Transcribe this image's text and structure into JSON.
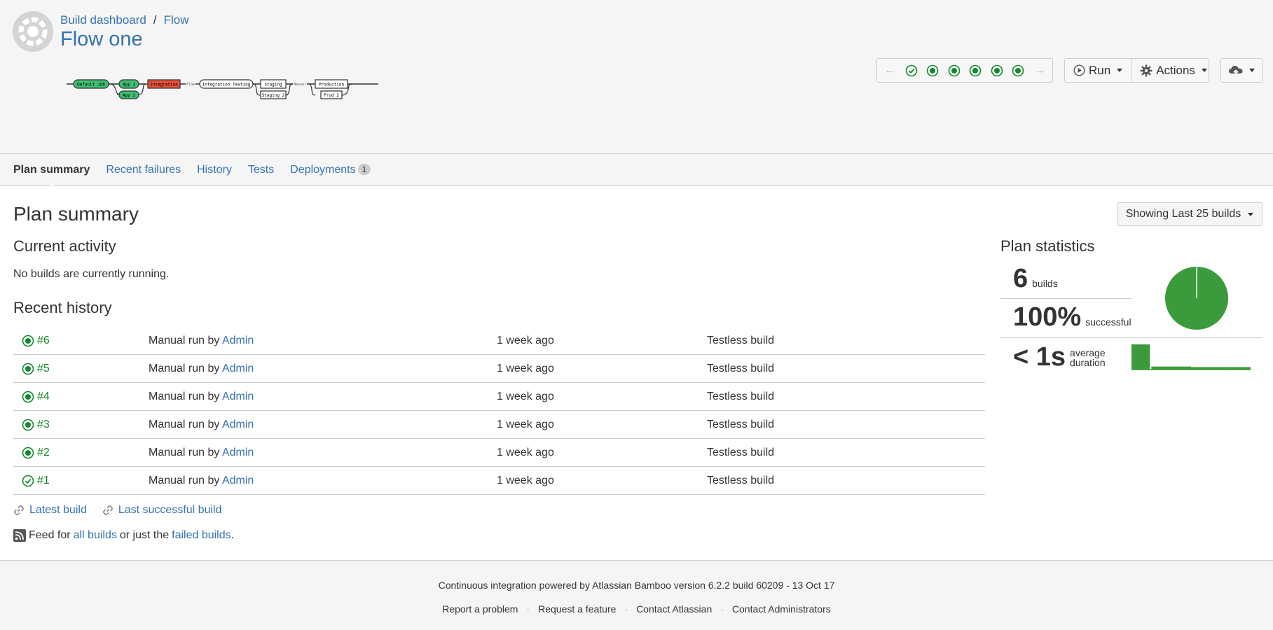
{
  "header": {
    "breadcrumb": [
      "Build dashboard",
      "Flow"
    ],
    "title": "Flow one",
    "pipeline": {
      "stages": [
        {
          "label": "Default Job",
          "status": "success"
        },
        {
          "label": "App 1",
          "status": "success"
        },
        {
          "label": "App 2",
          "status": "success"
        },
        {
          "label": "Integration",
          "status": "failed"
        },
        {
          "label": "Integration Testing",
          "status": "neutral"
        },
        {
          "label": "Staging",
          "status": "neutral"
        },
        {
          "label": "Staging 2",
          "status": "neutral"
        },
        {
          "label": "Production",
          "status": "neutral"
        },
        {
          "label": "Prod 2",
          "status": "neutral"
        }
      ],
      "connectors": [
        "Flow",
        "Manual"
      ]
    },
    "build_nav": {
      "prev_icon": "arrow-left-icon",
      "next_icon": "arrow-right-icon",
      "builds": [
        "success-check",
        "success",
        "success",
        "success",
        "success",
        "success"
      ]
    },
    "run_label": "Run",
    "actions_label": "Actions",
    "deploy_icon": "cloud-upload-icon"
  },
  "tabs": [
    {
      "label": "Plan summary",
      "active": true
    },
    {
      "label": "Recent failures"
    },
    {
      "label": "History"
    },
    {
      "label": "Tests"
    },
    {
      "label": "Deployments",
      "badge": "1"
    }
  ],
  "main": {
    "title": "Plan summary",
    "showing_label": "Showing Last 25 builds",
    "current_activity": {
      "heading": "Current activity",
      "text": "No builds are currently running."
    },
    "recent_history": {
      "heading": "Recent history",
      "rows": [
        {
          "build": "#6",
          "status": "success",
          "prefix": "Manual run by",
          "user": "Admin",
          "when": "1 week ago",
          "tests": "Testless build"
        },
        {
          "build": "#5",
          "status": "success",
          "prefix": "Manual run by",
          "user": "Admin",
          "when": "1 week ago",
          "tests": "Testless build"
        },
        {
          "build": "#4",
          "status": "success",
          "prefix": "Manual run by",
          "user": "Admin",
          "when": "1 week ago",
          "tests": "Testless build"
        },
        {
          "build": "#3",
          "status": "success",
          "prefix": "Manual run by",
          "user": "Admin",
          "when": "1 week ago",
          "tests": "Testless build"
        },
        {
          "build": "#2",
          "status": "success",
          "prefix": "Manual run by",
          "user": "Admin",
          "when": "1 week ago",
          "tests": "Testless build"
        },
        {
          "build": "#1",
          "status": "success-check",
          "prefix": "Manual run by",
          "user": "Admin",
          "when": "1 week ago",
          "tests": "Testless build"
        }
      ]
    },
    "links": {
      "latest": "Latest build",
      "last_successful": "Last successful build"
    },
    "feed": {
      "prefix": "Feed for",
      "all": "all builds",
      "middle": "or just the",
      "failed": "failed builds",
      "suffix": "."
    }
  },
  "statistics": {
    "heading": "Plan statistics",
    "builds_count": "6",
    "builds_label": "builds",
    "success_rate": "100%",
    "success_label": "successful",
    "success_fraction": 1.0,
    "avg_duration": "< 1s",
    "avg_label_1": "average",
    "avg_label_2": "duration",
    "duration_bars": [
      1.0,
      0.12,
      0.12,
      0.1,
      0.1,
      0.1
    ],
    "success_color": "#3b9a3b"
  },
  "footer": {
    "powered": "Continuous integration powered by Atlassian Bamboo version 6.2.2 build 60209 - 13 Oct 17",
    "links": [
      "Report a problem",
      "Request a feature",
      "Contact Atlassian",
      "Contact Administrators"
    ]
  }
}
